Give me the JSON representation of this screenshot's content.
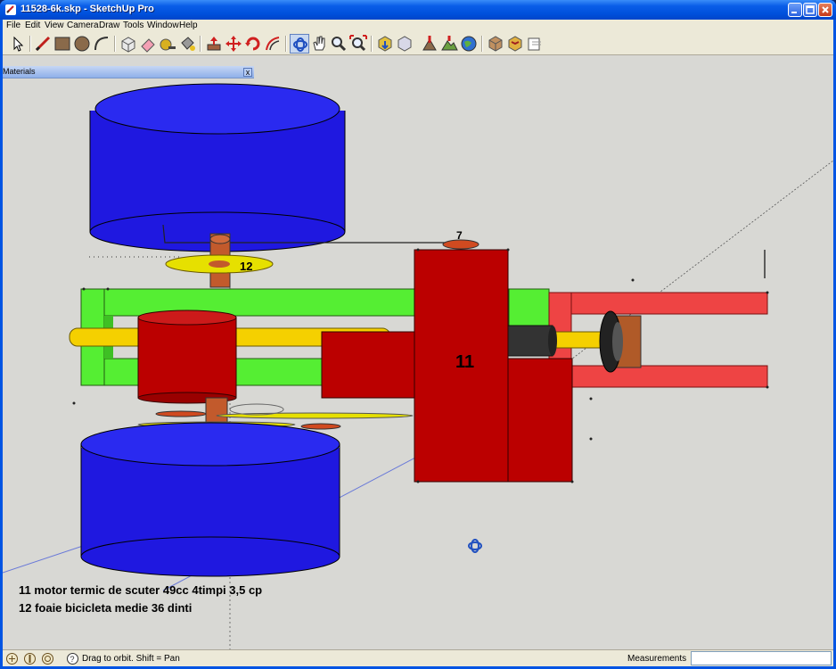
{
  "window": {
    "title": "11528-6k.skp - SketchUp Pro"
  },
  "menubar": {
    "items": [
      "File",
      "Edit",
      "View",
      "Camera",
      "Draw",
      "Tools",
      "Window",
      "Help"
    ]
  },
  "toolbar": {
    "tools": [
      "select-icon",
      "line-icon",
      "rectangle-icon",
      "circle-icon",
      "arc-icon",
      "make-component-icon",
      "eraser-icon",
      "tape-measure-icon",
      "paint-bucket-icon",
      "push-pull-icon",
      "move-icon",
      "rotate-icon",
      "offset-icon",
      "orbit-icon",
      "pan-icon",
      "zoom-icon",
      "zoom-extents-icon",
      "get-models-icon",
      "share-model-icon",
      "add-location-icon",
      "toggle-terrain-icon",
      "google-earth-icon",
      "components-icon",
      "warehouse-icon",
      "send-to-layout-icon"
    ]
  },
  "materials_panel": {
    "title": "Materials",
    "close_label": "x"
  },
  "model": {
    "labels": {
      "engine": "11",
      "chainring": "12",
      "sprocket_top": "7"
    },
    "colors": {
      "wheel": "#1f18e0",
      "frame_green": "#55ee33",
      "frame_red": "#ee4444",
      "engine_red": "#bb0000",
      "axle_yellow": "#f5d000",
      "sprocket_yellow": "#e6e000",
      "hub_brown": "#c25a2c",
      "viewport_bg": "#d8d8d4"
    }
  },
  "annotation": {
    "line1": "11 motor termic de scuter 49cc 4timpi 3,5 cp",
    "line2": "12 foaie bicicleta medie 36 dinti"
  },
  "statusbar": {
    "icons": [
      "geo-location-icon",
      "credits-icon",
      "user-icon"
    ],
    "hint": "Drag to orbit.  Shift = Pan",
    "measurements_label": "Measurements",
    "measurements_value": ""
  }
}
